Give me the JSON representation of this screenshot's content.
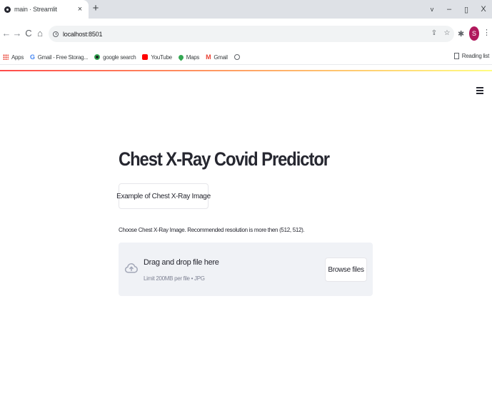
{
  "browser": {
    "tab": {
      "title": "main · Streamlit",
      "close": "×"
    },
    "new_tab": "+",
    "window_controls": {
      "chevron": "v",
      "minimize": "–",
      "restore": "▯",
      "close": "X"
    },
    "nav": {
      "back": "←",
      "forward": "→",
      "reload": "C",
      "home": "⌂"
    },
    "url": "localhost:8501",
    "profile_initial": "S",
    "bookmarks": [
      {
        "label": "Apps",
        "icon": "apps-grid-icon"
      },
      {
        "label": "Gmail - Free Storag...",
        "icon": "google-icon"
      },
      {
        "label": "google search",
        "icon": "search-icon"
      },
      {
        "label": "YouTube",
        "icon": "youtube-icon"
      },
      {
        "label": "Maps",
        "icon": "maps-pin-icon"
      },
      {
        "label": "Gmail",
        "icon": "gmail-icon"
      },
      {
        "label": "",
        "icon": "globe-icon"
      }
    ],
    "reading_list": "Reading list"
  },
  "app": {
    "title": "Chest X-Ray Covid Predictor",
    "example_button": "Example of Chest X-Ray Image",
    "uploader": {
      "label": "Choose Chest X-Ray Image. Recommended resolution is more then (512, 512).",
      "drag_text": "Drag and drop file here",
      "limit_text": "Limit 200MB per file • JPG",
      "browse_button": "Browse files"
    }
  },
  "colors": {
    "accent_start": "#ff4b4b",
    "accent_end": "#fffd80",
    "dropzone_bg": "#f0f2f6",
    "profile_bg": "#b0185c"
  }
}
